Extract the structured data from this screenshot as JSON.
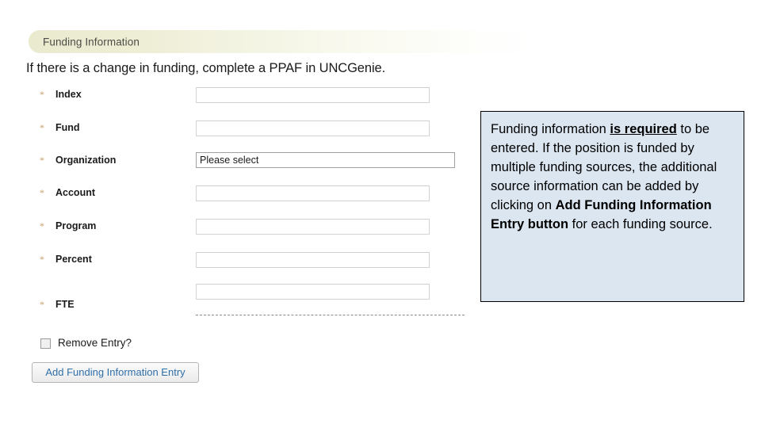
{
  "section": {
    "banner_title": "Funding Information",
    "instruction": "If there is a change in funding, complete a PPAF in UNCGenie."
  },
  "form": {
    "required_marker": "*",
    "fields": [
      {
        "label": "Index",
        "type": "text",
        "value": "",
        "required": true
      },
      {
        "label": "Fund",
        "type": "text",
        "value": "",
        "required": true
      },
      {
        "label": "Organization",
        "type": "select",
        "value": "Please select",
        "required": true
      },
      {
        "label": "Account",
        "type": "text",
        "value": "",
        "required": true
      },
      {
        "label": "Program",
        "type": "text",
        "value": "",
        "required": true
      },
      {
        "label": "Percent",
        "type": "text",
        "value": "",
        "required": true
      },
      {
        "label": "FTE",
        "type": "text",
        "value": "",
        "required": true
      }
    ],
    "organization_options": [
      "Please select"
    ],
    "remove_entry_label": "Remove Entry?",
    "remove_entry_checked": false,
    "add_entry_button_label": "Add Funding Information Entry"
  },
  "callout": {
    "text_plain": "Funding information is required to be entered. If the position is funded by multiple funding sources, the additional source information can be added by clicking on Add Funding Information Entry button for each funding source.",
    "segments": [
      {
        "text": "Funding information ",
        "bold": false,
        "underline": false
      },
      {
        "text": "is required",
        "bold": true,
        "underline": true
      },
      {
        "text": " to be entered. If the position is funded by multiple funding sources, the additional source information can be added by clicking on ",
        "bold": false,
        "underline": false
      },
      {
        "text": "Add Funding Information Entry button",
        "bold": true,
        "underline": false
      },
      {
        "text": " for each funding source.",
        "bold": false,
        "underline": false
      }
    ]
  },
  "colors": {
    "banner_start": "#eaeacf",
    "banner_end": "#ffffff",
    "required_star": "#c8a06a",
    "callout_bg": "#dce6f1",
    "callout_border": "#000000",
    "button_text": "#2f6fa8"
  }
}
